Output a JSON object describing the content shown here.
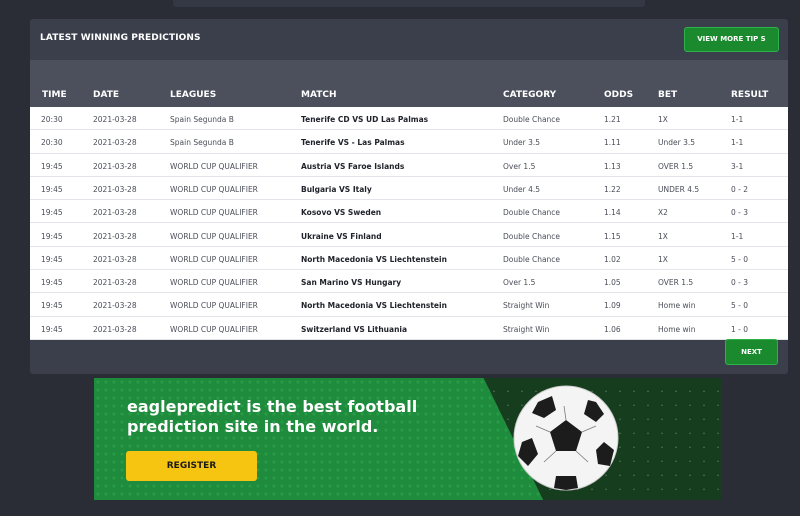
{
  "panel": {
    "title": "LATEST WINNING PREDICTIONS",
    "view_more_label": "VIEW MORE TIP S",
    "next_label": "NEXT"
  },
  "table": {
    "headers": {
      "time": "TIME",
      "date": "DATE",
      "leagues": "LEAGUES",
      "match": "MATCH",
      "category": "CATEGORY",
      "odds": "ODDS",
      "bet": "BET",
      "result": "RESULT"
    },
    "rows": [
      {
        "time": "20:30",
        "date": "2021-03-28",
        "league": "Spain Segunda B",
        "match": "Tenerife CD VS UD Las Palmas",
        "category": "Double Chance",
        "odds": "1.21",
        "bet": "1X",
        "result": "1-1"
      },
      {
        "time": "20:30",
        "date": "2021-03-28",
        "league": "Spain Segunda B",
        "match": "Tenerife VS - Las Palmas",
        "category": "Under 3.5",
        "odds": "1.11",
        "bet": "Under 3.5",
        "result": "1-1"
      },
      {
        "time": "19:45",
        "date": "2021-03-28",
        "league": "WORLD CUP QUALIFIER",
        "match": "Austria VS Faroe Islands",
        "category": "Over 1.5",
        "odds": "1.13",
        "bet": "OVER 1.5",
        "result": "3-1"
      },
      {
        "time": "19:45",
        "date": "2021-03-28",
        "league": "WORLD CUP QUALIFIER",
        "match": "Bulgaria VS Italy",
        "category": "Under 4.5",
        "odds": "1.22",
        "bet": "UNDER 4.5",
        "result": "0 - 2"
      },
      {
        "time": "19:45",
        "date": "2021-03-28",
        "league": "WORLD CUP QUALIFIER",
        "match": "Kosovo VS Sweden",
        "category": "Double Chance",
        "odds": "1.14",
        "bet": "X2",
        "result": "0 - 3"
      },
      {
        "time": "19:45",
        "date": "2021-03-28",
        "league": "WORLD CUP QUALIFIER",
        "match": "Ukraine VS Finland",
        "category": "Double Chance",
        "odds": "1.15",
        "bet": "1X",
        "result": "1-1"
      },
      {
        "time": "19:45",
        "date": "2021-03-28",
        "league": "WORLD CUP QUALIFIER",
        "match": "North Macedonia VS Liechtenstein",
        "category": "Double Chance",
        "odds": "1.02",
        "bet": "1X",
        "result": "5 - 0"
      },
      {
        "time": "19:45",
        "date": "2021-03-28",
        "league": "WORLD CUP QUALIFIER",
        "match": "San Marino VS Hungary",
        "category": "Over 1.5",
        "odds": "1.05",
        "bet": "OVER 1.5",
        "result": "0 - 3"
      },
      {
        "time": "19:45",
        "date": "2021-03-28",
        "league": "WORLD CUP QUALIFIER",
        "match": "North Macedonia VS Liechtenstein",
        "category": "Straight Win",
        "odds": "1.09",
        "bet": "Home win",
        "result": "5 - 0"
      },
      {
        "time": "19:45",
        "date": "2021-03-28",
        "league": "WORLD CUP QUALIFIER",
        "match": "Switzerland VS Lithuania",
        "category": "Straight Win",
        "odds": "1.06",
        "bet": "Home win",
        "result": "1 - 0"
      }
    ]
  },
  "banner": {
    "headline": "eaglepredict is the best football prediction site in the world.",
    "register_label": "REGISTER"
  },
  "colors": {
    "accent_green": "#1b8a2e",
    "register_yellow": "#f6c512",
    "page_bg": "#2a2d36"
  }
}
